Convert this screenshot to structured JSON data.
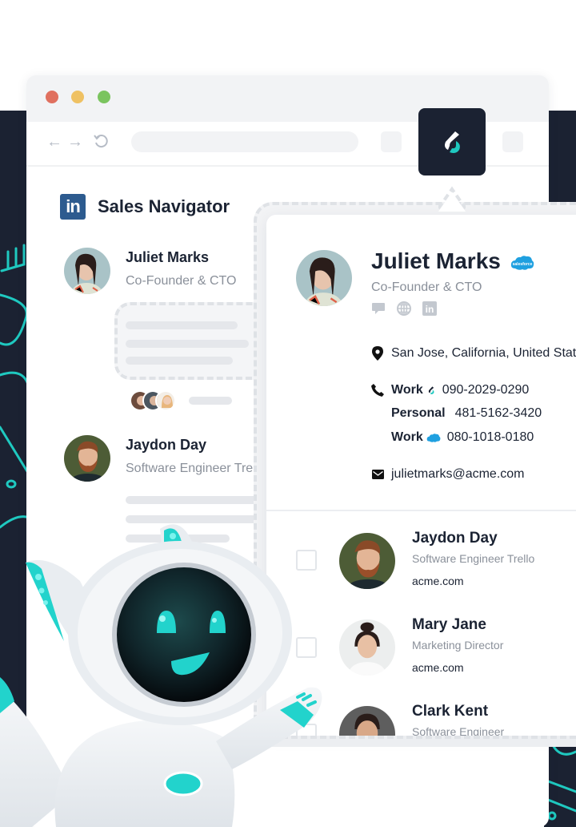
{
  "browser": {
    "window_controls": [
      "close",
      "minimize",
      "maximize"
    ],
    "nav": {
      "back_icon": "arrow-left-icon",
      "forward_icon": "arrow-right-icon",
      "reload_icon": "reload-icon"
    },
    "extension_icon": "extension-logo-icon"
  },
  "sales_navigator": {
    "logo_text": "in",
    "title": "Sales Navigator",
    "leads": [
      {
        "name": "Juliet Marks",
        "title": "Co-Founder & CTO"
      },
      {
        "name": "Jaydon Day",
        "title": "Software Engineer Trello"
      }
    ]
  },
  "profile_card": {
    "name": "Juliet Marks",
    "crm_badge": "salesforce",
    "title": "Co-Founder & CTO",
    "social_icons": [
      "chat-icon",
      "globe-icon",
      "linkedin-icon"
    ],
    "location": "San Jose, California, United States",
    "phones": [
      {
        "label": "Work",
        "source": "extension",
        "number": "090-2029-0290"
      },
      {
        "label": "Personal",
        "source": "",
        "number": "481-5162-3420"
      },
      {
        "label": "Work",
        "source": "salesforce",
        "number": "080-1018-0180"
      }
    ],
    "email": "julietmarks@acme.com"
  },
  "contacts": [
    {
      "name": "Jaydon Day",
      "title": "Software Engineer Trello",
      "domain": "acme.com",
      "checked": false
    },
    {
      "name": "Mary Jane",
      "title": "Marketing Director",
      "domain": "acme.com",
      "checked": false
    },
    {
      "name": "Clark Kent",
      "title": "Software Engineer",
      "domain": "",
      "checked": false
    }
  ],
  "colors": {
    "dark_navy": "#1b2232",
    "accent_teal": "#1fc9c0",
    "linkedin_blue": "#2d5b8f",
    "salesforce_blue": "#1fa0e0",
    "text_primary": "#1b2333",
    "text_secondary": "#8a909a"
  }
}
